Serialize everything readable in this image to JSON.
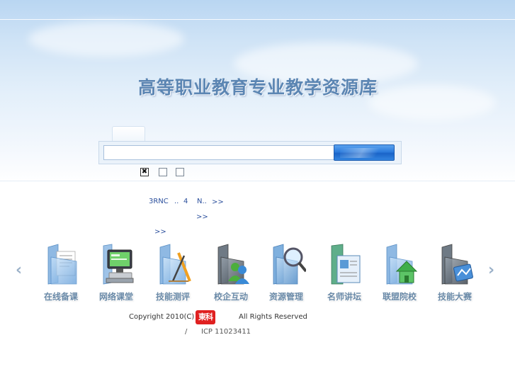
{
  "site": {
    "title": "高等职业教育专业教学资源库"
  },
  "search": {
    "tab_label": "",
    "placeholder": "",
    "value": "",
    "button_label": "",
    "options": [
      {
        "checked": true
      },
      {
        "checked": false
      },
      {
        "checked": false
      }
    ]
  },
  "links": {
    "row1": {
      "a": "3RNC",
      "sep": "..",
      "page": "4",
      "b": "N..",
      "more": ">>"
    },
    "row2": {
      "more": ">>"
    },
    "row3": {
      "more": ">>"
    }
  },
  "carousel": {
    "prev_glyph": "‹",
    "next_glyph": "›",
    "items": [
      {
        "label": "在线备课",
        "icon": "folder-document-icon"
      },
      {
        "label": "网络课堂",
        "icon": "computer-monitor-icon"
      },
      {
        "label": "技能测评",
        "icon": "folder-tools-icon"
      },
      {
        "label": "校企互动",
        "icon": "folder-users-icon"
      },
      {
        "label": "资源管理",
        "icon": "folder-search-icon"
      },
      {
        "label": "名师讲坛",
        "icon": "presentation-icon"
      },
      {
        "label": "联盟院校",
        "icon": "folder-home-icon"
      },
      {
        "label": "技能大赛",
        "icon": "folder-contest-icon"
      }
    ]
  },
  "footer": {
    "copyright": "Copyright 2010(C)",
    "seal_text": "東科",
    "rights": "All Rights Reserved",
    "slash": "/",
    "icp": "ICP 11023411"
  },
  "colors": {
    "accent": "#2c7bdc",
    "link": "#2b4f9c",
    "title": "#5c86b3",
    "seal": "#e02020"
  }
}
